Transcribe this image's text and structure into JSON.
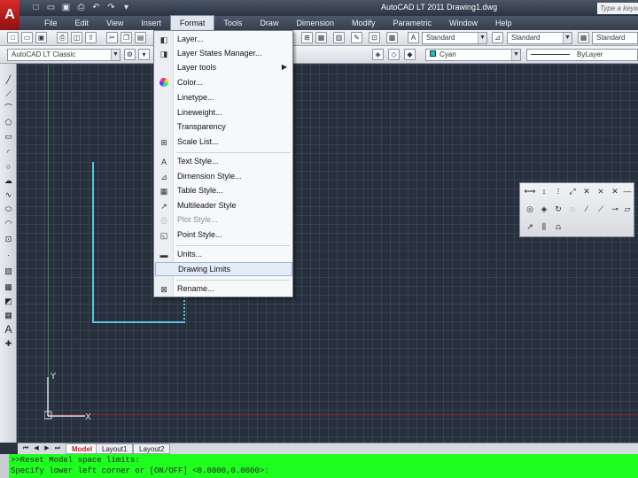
{
  "titlebar": {
    "app_logo": "A",
    "title": "AutoCAD LT 2011   Drawing1.dwg",
    "search_placeholder": "Type a keyw",
    "quick_access": [
      "new-icon",
      "open-icon",
      "save-icon",
      "print-icon",
      "undo-icon",
      "redo-icon",
      "dropdown-icon"
    ]
  },
  "menubar": {
    "items": [
      "File",
      "Edit",
      "View",
      "Insert",
      "Format",
      "Tools",
      "Draw",
      "Dimension",
      "Modify",
      "Parametric",
      "Window",
      "Help"
    ],
    "active": "Format"
  },
  "toolbar1": {
    "text_style": "Standard",
    "dim_style": "Standard",
    "table_style": "Standard"
  },
  "toolbar2": {
    "workspace": "AutoCAD LT Classic",
    "color": "Cyan",
    "linetype": "ByLayer"
  },
  "format_menu": {
    "items": [
      {
        "label": "Layer...",
        "icon": "layer-icon"
      },
      {
        "label": "Layer States Manager...",
        "icon": "layer-states-icon"
      },
      {
        "label": "Layer tools",
        "icon": "",
        "submenu": true
      },
      {
        "label": "Color...",
        "icon": "color-wheel-icon"
      },
      {
        "label": "Linetype...",
        "icon": ""
      },
      {
        "label": "Lineweight...",
        "icon": ""
      },
      {
        "label": "Transparency",
        "icon": ""
      },
      {
        "label": "Scale List...",
        "icon": "scale-list-icon"
      },
      {
        "label": "Text Style...",
        "icon": "text-style-icon"
      },
      {
        "label": "Dimension Style...",
        "icon": "dimension-style-icon"
      },
      {
        "label": "Table Style...",
        "icon": "table-style-icon"
      },
      {
        "label": "Multileader Style",
        "icon": "multileader-style-icon"
      },
      {
        "label": "Plot Style...",
        "icon": "plot-style-icon"
      },
      {
        "label": "Point Style...",
        "icon": "point-style-icon"
      },
      {
        "label": "Units...",
        "icon": "units-icon"
      },
      {
        "label": "Drawing Limits",
        "icon": "",
        "highlighted": true
      },
      {
        "label": "Rename...",
        "icon": "rename-icon"
      }
    ],
    "submenu_arrow": "▶"
  },
  "drawing": {
    "ucs_x": "X",
    "ucs_y": "Y"
  },
  "tabs": {
    "model": "Model",
    "layout1": "Layout1",
    "layout2": "Layout2"
  },
  "command_line": {
    "line1": ">>Reset Model space limits:",
    "line2": "Specify lower left corner or [ON/OFF] <0.0000,0.0000>:"
  }
}
